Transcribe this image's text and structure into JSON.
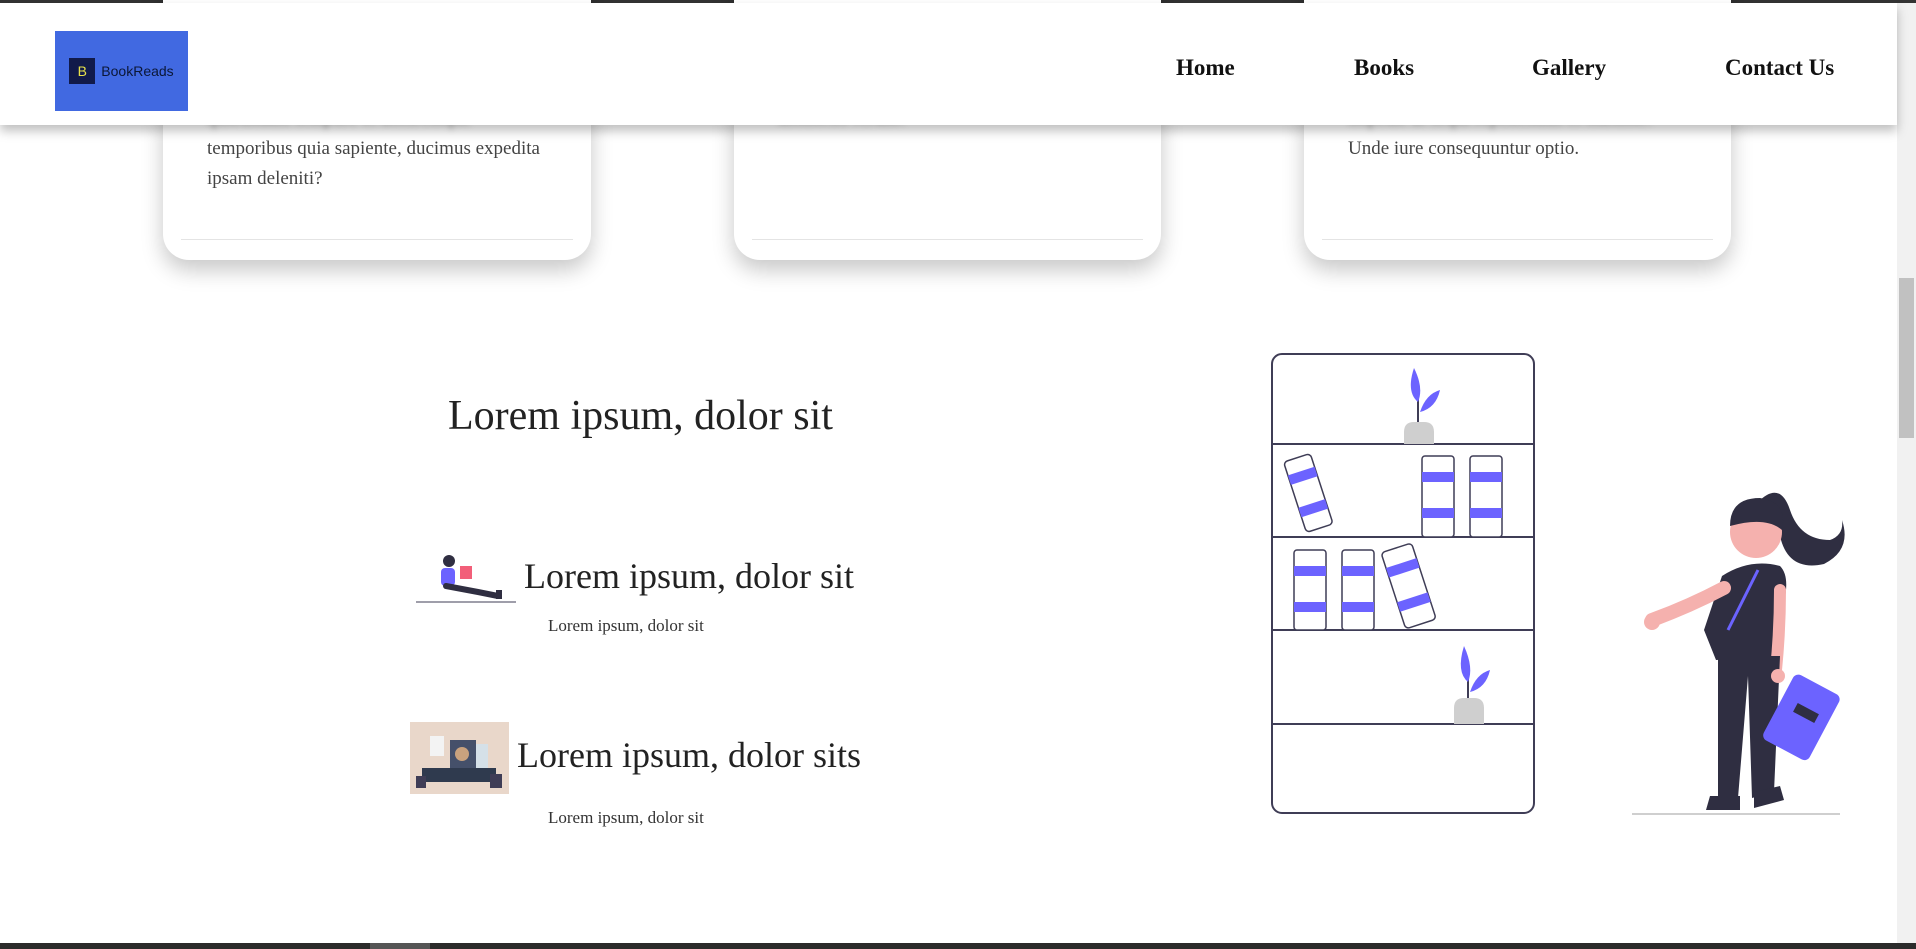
{
  "nav": {
    "logo_mark": "B",
    "logo_text": "BookReads",
    "links": [
      "Home",
      "Books",
      "Gallery",
      "Contact Us"
    ]
  },
  "cards": [
    {
      "hidden_text": "quibusdam tempore et doloremque",
      "text": "temporibus quia sapiente, ducimus expedita ipsam deleniti?"
    },
    {
      "hidden_text": "distinctio rerum?",
      "text": ""
    },
    {
      "hidden_text": "impedit ut sequi repellendus et maxime.",
      "text": "Unde iure consequuntur optio."
    }
  ],
  "section": {
    "title": "Lorem ipsum, dolor sit",
    "features": [
      {
        "title": "Lorem ipsum, dolor sit",
        "subtitle": "Lorem ipsum, dolor sit"
      },
      {
        "title": "Lorem ipsum, dolor sits",
        "subtitle": "Lorem ipsum, dolor sit"
      }
    ]
  },
  "illustration": {
    "accent": "#6c63ff",
    "skin": "#f5b1ae",
    "dark": "#2f2e41",
    "outline": "#3f3d56"
  }
}
